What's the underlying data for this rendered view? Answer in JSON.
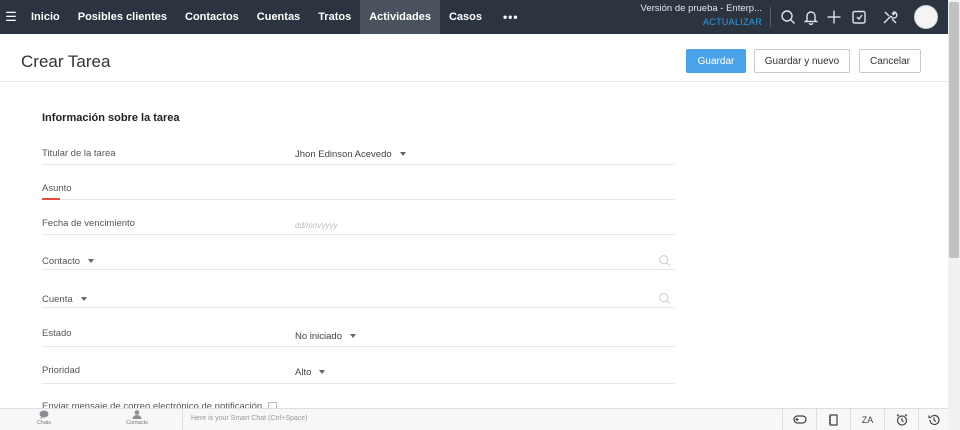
{
  "nav": {
    "items": [
      {
        "label": "Inicio",
        "active": false
      },
      {
        "label": "Posibles clientes",
        "active": false
      },
      {
        "label": "Contactos",
        "active": false
      },
      {
        "label": "Cuentas",
        "active": false
      },
      {
        "label": "Tratos",
        "active": false
      },
      {
        "label": "Actividades",
        "active": true
      },
      {
        "label": "Casos",
        "active": false
      }
    ],
    "more": "•••",
    "trial_text": "Versión de prueba - Enterp...",
    "upgrade_link": "ACTUALIZAR",
    "icons": [
      "search-icon",
      "bell-icon",
      "plus-icon",
      "calendar-icon",
      "tools-icon",
      "avatar"
    ]
  },
  "header": {
    "title": "Crear Tarea",
    "save": "Guardar",
    "save_new": "Guardar y nuevo",
    "cancel": "Cancelar"
  },
  "form": {
    "section_title": "Información sobre la tarea",
    "fields": {
      "owner": {
        "label": "Titular de la tarea",
        "value": "Jhon Edinson Acevedo"
      },
      "subject": {
        "label": "Asunto",
        "value": ""
      },
      "due_date": {
        "label": "Fecha de vencimiento",
        "placeholder": "dd/mm/yyyy"
      },
      "contact": {
        "label": "Contacto"
      },
      "account": {
        "label": "Cuenta"
      },
      "status": {
        "label": "Estado",
        "value": "No iniciado"
      },
      "priority": {
        "label": "Prioridad",
        "value": "Alto"
      },
      "notify": {
        "label": "Enviar mensaje de correo electrónico de notificación"
      }
    }
  },
  "bottom": {
    "chats_label": "Chats",
    "contacts_label": "Contacts",
    "chat_placeholder": "Here is your Smart Chat (Ctrl+Space)",
    "za_label": "ZA"
  },
  "colors": {
    "topbar": "#2c3440",
    "primary": "#4aa2e8",
    "link": "#2d9be6",
    "required": "#e24b3b"
  }
}
